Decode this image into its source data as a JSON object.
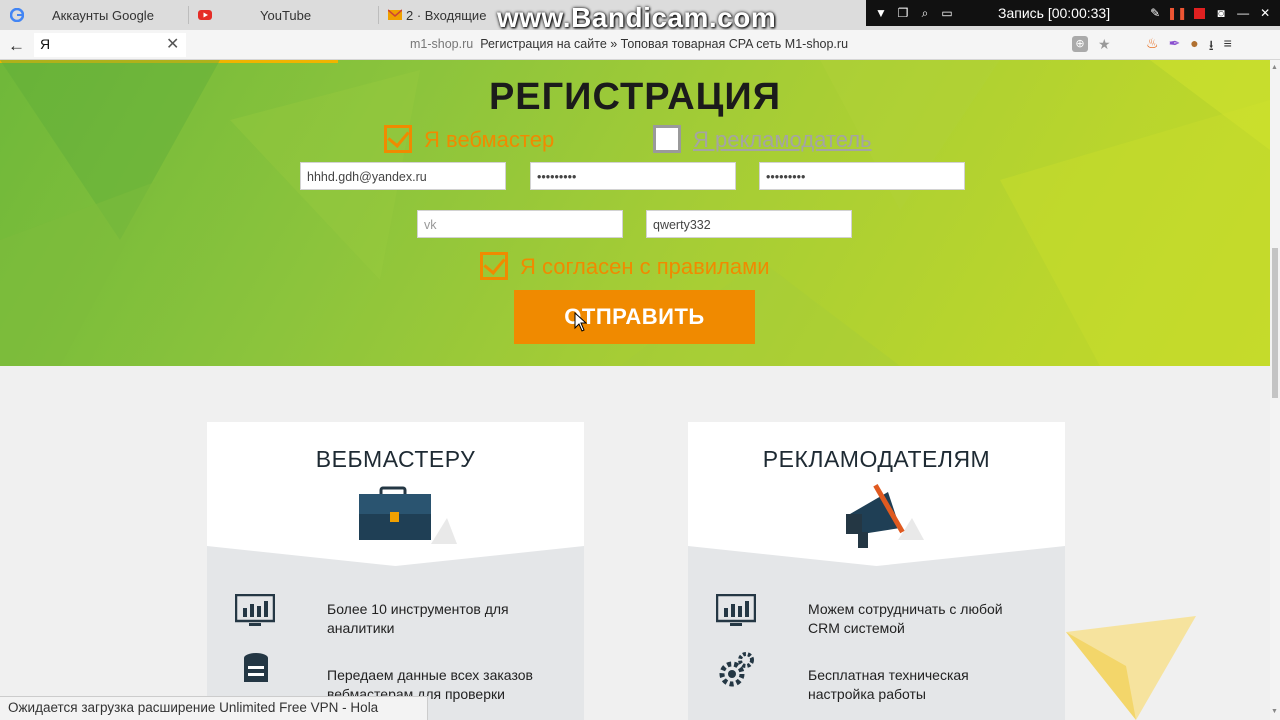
{
  "browser": {
    "tabs": [
      {
        "label": "Аккаунты Google",
        "icon": "google-icon"
      },
      {
        "label": "YouTube",
        "icon": "youtube-icon"
      },
      {
        "label": "2 · Входящие",
        "icon": "mail-icon"
      }
    ],
    "back_icon": "back-arrow-icon",
    "omnibox_text": "Я",
    "url_domain": "m1-shop.ru",
    "url_title": "Регистрация на сайте » Топовая товарная CPA сеть M1-shop.ru",
    "status_text": "Ожидается загрузка расширение Unlimited Free VPN - Hola"
  },
  "recorder": {
    "watermark": "www.Bandicam.com",
    "record_label": "Запись [00:00:33]"
  },
  "registration": {
    "title": "РЕГИСТРАЦИЯ",
    "role_webmaster": {
      "label": "Я вебмастер",
      "checked": true
    },
    "role_advertiser": {
      "label": "Я рекламодатель",
      "checked": false
    },
    "email_value": "hhhd.gdh@yandex.ru",
    "password_value": "•••••••••",
    "password_confirm_value": "•••••••••",
    "messenger_placeholder": "vk",
    "login_value": "qwerty332",
    "agree": {
      "label": "Я согласен с правилами",
      "checked": true
    },
    "submit_label": "ОТПРАВИТЬ"
  },
  "cards": [
    {
      "title": "ВЕБМАСТЕРУ",
      "icon": "briefcase-icon",
      "features": [
        {
          "icon": "monitor-chart-icon",
          "text": "Более 10 инструментов для аналитики"
        },
        {
          "icon": "database-icon",
          "text": "Передаем данные всех заказов вебмастерам для проверки"
        }
      ]
    },
    {
      "title": "РЕКЛАМОДАТЕЛЯМ",
      "icon": "megaphone-icon",
      "features": [
        {
          "icon": "monitor-chart-icon",
          "text": "Можем сотрудничать с любой CRM системой"
        },
        {
          "icon": "gears-icon",
          "text": "Бесплатная техническая настройка работы"
        }
      ]
    }
  ],
  "colors": {
    "accent_orange": "#f08a00",
    "hero_green": "#8cc43c",
    "title_dark": "#1e2a33"
  }
}
